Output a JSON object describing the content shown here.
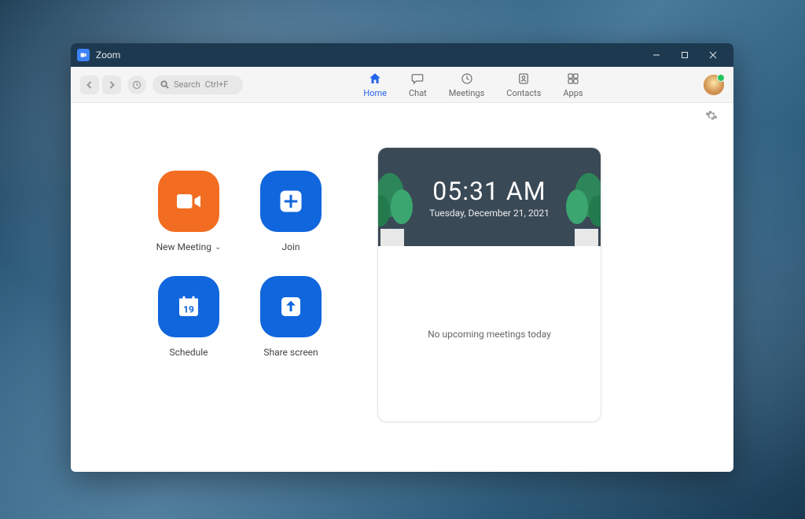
{
  "window": {
    "title": "Zoom"
  },
  "toolbar": {
    "search_label": "Search",
    "search_shortcut": "Ctrl+F"
  },
  "tabs": {
    "home": "Home",
    "chat": "Chat",
    "meetings": "Meetings",
    "contacts": "Contacts",
    "apps": "Apps"
  },
  "actions": {
    "new_meeting": "New Meeting",
    "join": "Join",
    "schedule": "Schedule",
    "schedule_day": "19",
    "share_screen": "Share screen"
  },
  "card": {
    "time": "05:31 AM",
    "date": "Tuesday, December 21, 2021",
    "empty_message": "No upcoming meetings today"
  },
  "colors": {
    "accent_orange": "#f26d21",
    "accent_blue": "#1066dd",
    "titlebar": "#1c3950"
  }
}
